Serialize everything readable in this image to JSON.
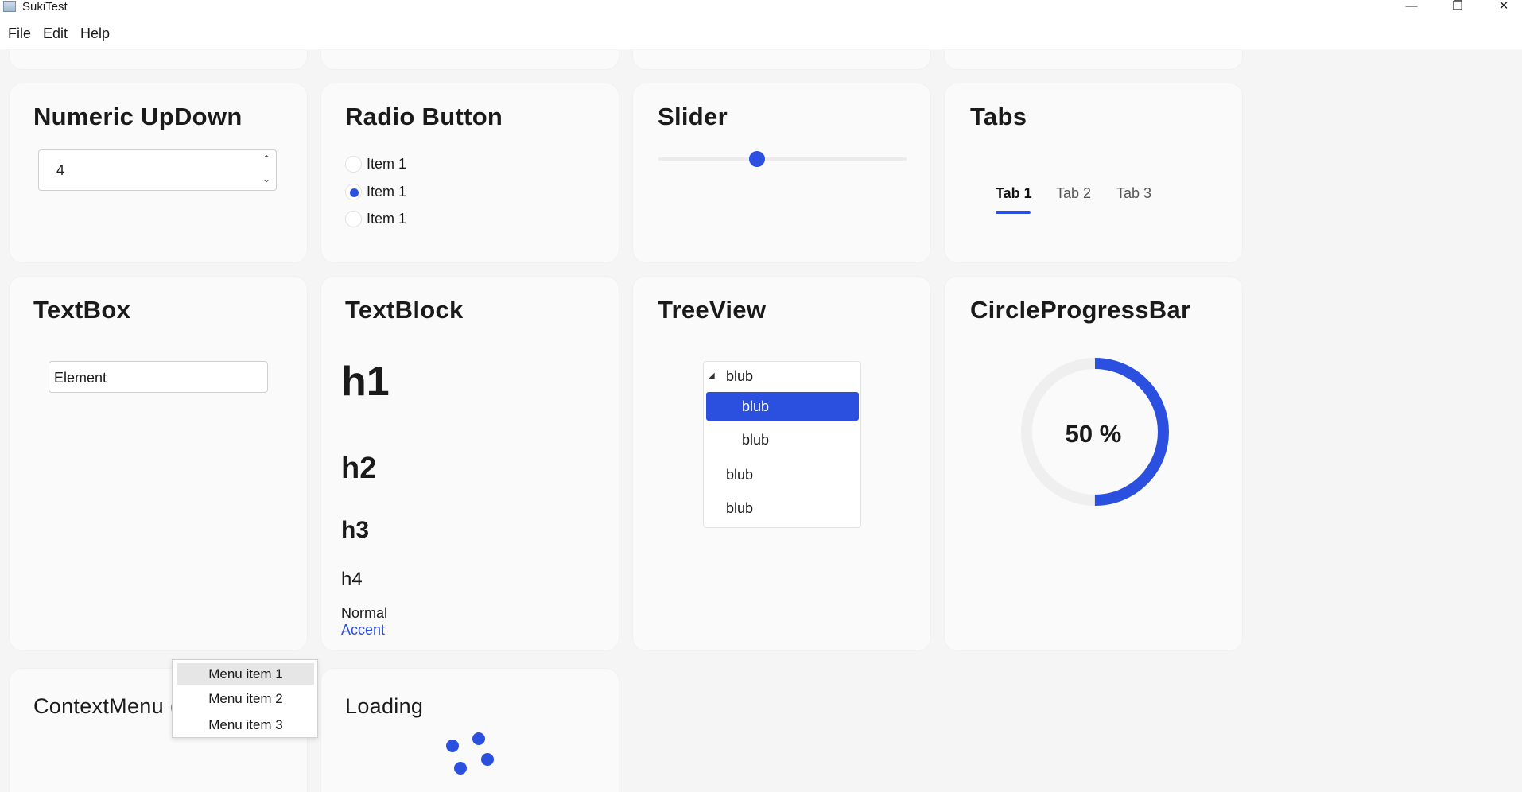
{
  "window": {
    "title": "SukiTest",
    "controls": {
      "minimize": "—",
      "maximize": "❐",
      "close": "✕"
    }
  },
  "menubar": {
    "items": [
      "File",
      "Edit",
      "Help"
    ]
  },
  "cards": {
    "numeric": {
      "title": "Numeric UpDown",
      "value": "4"
    },
    "radio": {
      "title": "Radio Button",
      "items": [
        {
          "label": "Item 1",
          "checked": false
        },
        {
          "label": "Item 1",
          "checked": true
        },
        {
          "label": "Item 1",
          "checked": false
        }
      ]
    },
    "slider": {
      "title": "Slider",
      "value_fraction": 0.4
    },
    "tabs": {
      "title": "Tabs",
      "items": [
        "Tab 1",
        "Tab 2",
        "Tab 3"
      ],
      "active": "Tab 1"
    },
    "textbox": {
      "title": "TextBox",
      "value": "Element"
    },
    "textblock": {
      "title": "TextBlock",
      "h1": "h1",
      "h2": "h2",
      "h3": "h3",
      "h4": "h4",
      "normal": "Normal",
      "accent": "Accent"
    },
    "treeview": {
      "title": "TreeView",
      "items": [
        {
          "label": "blub",
          "expanded": true
        },
        {
          "label": "blub",
          "selected": true
        },
        {
          "label": "blub"
        },
        {
          "label": "blub"
        },
        {
          "label": "blub"
        }
      ]
    },
    "circle_progress": {
      "title": "CircleProgressBar",
      "label": "50 %",
      "value_percent": 50
    },
    "context_menu": {
      "title": "ContextMenu (",
      "items": [
        "Menu item 1",
        "Menu item 2",
        "Menu item 3"
      ],
      "hovered": "Menu item 1"
    },
    "loading": {
      "title": "Loading"
    }
  },
  "colors": {
    "accent": "#2b50e0",
    "card": "#fafafa",
    "background": "#f5f5f5"
  }
}
